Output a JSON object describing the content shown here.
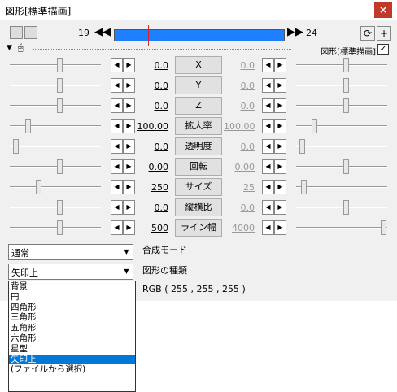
{
  "window": {
    "title": "図形[標準描画]",
    "close_label": "×"
  },
  "toolbar": {
    "start_frame": "19",
    "end_frame": "24",
    "rewind_label": "◀◀",
    "forward_label": "▶▶",
    "add_label": "+"
  },
  "object_label": "図形[標準描画]",
  "checkbox_label": "✓",
  "rows": [
    {
      "name": "X",
      "value": "0.0",
      "end_value": "0.0"
    },
    {
      "name": "Y",
      "value": "0.0",
      "end_value": "0.0"
    },
    {
      "name": "Z",
      "value": "0.0",
      "end_value": "0.0"
    },
    {
      "name": "拡大率",
      "value": "100.00",
      "end_value": "100.00"
    },
    {
      "name": "透明度",
      "value": "0.0",
      "end_value": "0.0"
    },
    {
      "name": "回転",
      "value": "0.00",
      "end_value": "0.00"
    },
    {
      "name": "サイズ",
      "value": "250",
      "end_value": "25"
    },
    {
      "name": "縦横比",
      "value": "0.0",
      "end_value": "0.0"
    },
    {
      "name": "ライン幅",
      "value": "500",
      "end_value": "4000"
    }
  ],
  "blend": {
    "value": "通常",
    "label": "合成モード"
  },
  "shape": {
    "value": "矢印上",
    "label": "図形の種類"
  },
  "color_text": "RGB ( 255 , 255 , 255 )",
  "dropdown_options": [
    "背景",
    "円",
    "四角形",
    "三角形",
    "五角形",
    "六角形",
    "星型",
    "矢印上",
    "(ファイルから選択)"
  ],
  "selected_option_index": 7,
  "sliders_left_pct": [
    0.55,
    0.55,
    0.55,
    0.18,
    0.04,
    0.55,
    0.3,
    0.55,
    0.55
  ],
  "sliders_right_pct": [
    0.55,
    0.55,
    0.55,
    0.18,
    0.04,
    0.55,
    0.06,
    0.55,
    0.98
  ]
}
